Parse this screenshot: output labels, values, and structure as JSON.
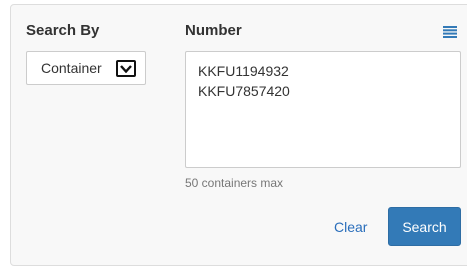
{
  "search_by": {
    "label": "Search By",
    "selected_value": "Container"
  },
  "number": {
    "label": "Number",
    "entries": [
      "KKFU1194932",
      "KKFU7857420"
    ],
    "hint": "50 containers max",
    "list_icon": "list-icon"
  },
  "actions": {
    "clear_label": "Clear",
    "search_label": "Search"
  },
  "colors": {
    "accent": "#337ab7",
    "link": "#2a6ebb",
    "panel_bg": "#f8f8f8"
  }
}
